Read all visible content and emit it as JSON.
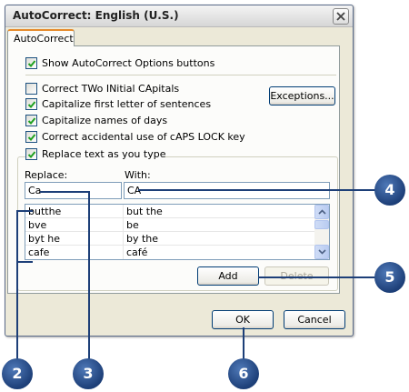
{
  "window": {
    "title": "AutoCorrect: English (U.S.)"
  },
  "tab": {
    "label": "AutoCorrect"
  },
  "options": {
    "show_buttons": {
      "label": "Show AutoCorrect Options buttons",
      "checked": true
    },
    "two_initial": {
      "label": "Correct TWo INitial CApitals",
      "checked": false
    },
    "first_letter": {
      "label": "Capitalize first letter of sentences",
      "checked": true
    },
    "days": {
      "label": "Capitalize names of days",
      "checked": true
    },
    "caps_lock": {
      "label": "Correct accidental use of cAPS LOCK key",
      "checked": true
    },
    "replace_text": {
      "label": "Replace text as you type",
      "checked": true
    }
  },
  "buttons": {
    "exceptions": "Exceptions...",
    "add": "Add",
    "delete": "Delete",
    "ok": "OK",
    "cancel": "Cancel"
  },
  "replace_group": {
    "replace_label": "Replace:",
    "with_label": "With:",
    "replace_value": "Ca",
    "with_value": "CA"
  },
  "entries": [
    {
      "replace": "butthe",
      "with": "but the"
    },
    {
      "replace": "bve",
      "with": "be"
    },
    {
      "replace": "byt he",
      "with": "by the"
    },
    {
      "replace": "cafe",
      "with": "café"
    }
  ],
  "callouts": {
    "c2": "2",
    "c3": "3",
    "c4": "4",
    "c5": "5",
    "c6": "6"
  },
  "colors": {
    "callout": "#1d3f78",
    "tab_highlight": "#e68b2c",
    "dialog_bg": "#ece9d8"
  }
}
